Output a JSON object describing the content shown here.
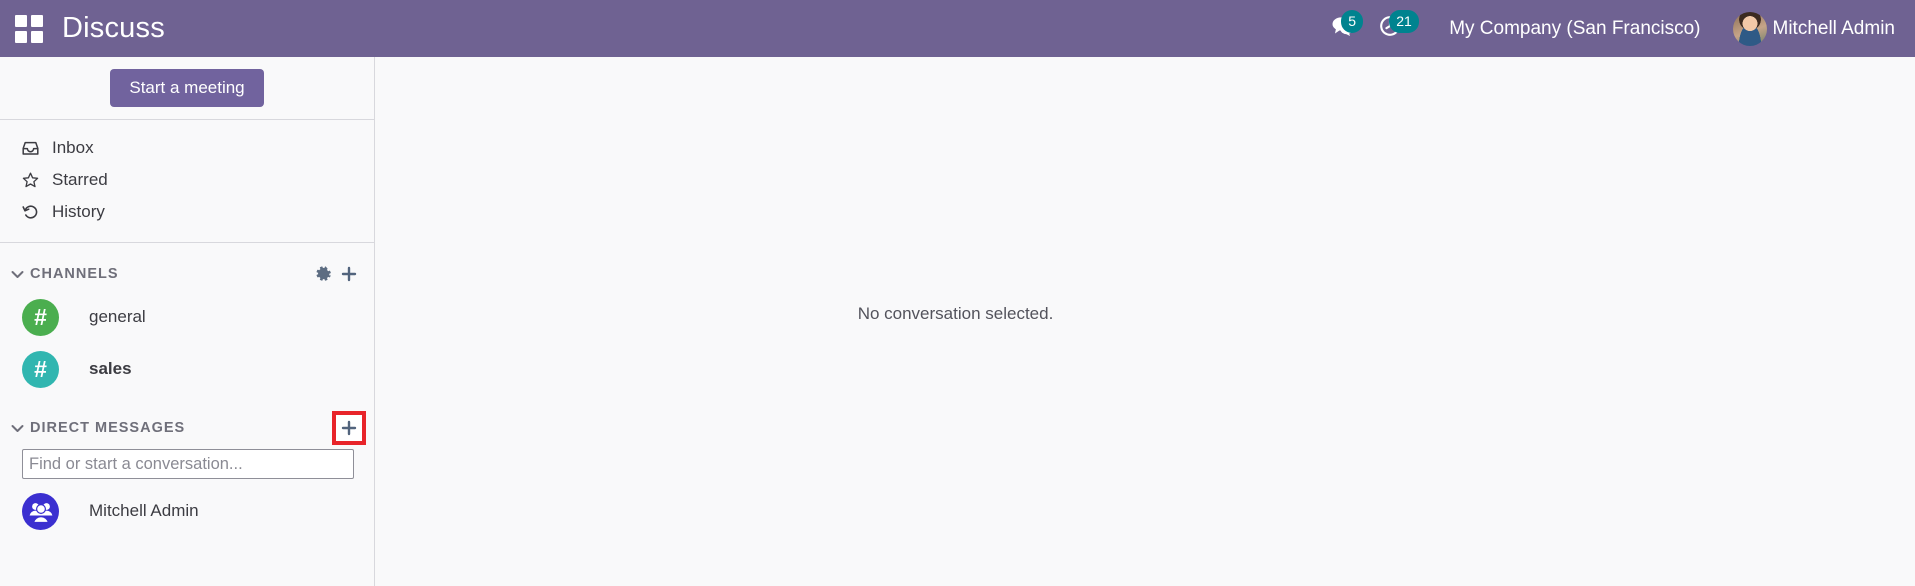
{
  "navbar": {
    "apps_menu_icon": "grid-apps-icon",
    "app_title": "Discuss",
    "messages_icon": "chat-bubbles-icon",
    "messages_count": "5",
    "activities_icon": "clock-activity-icon",
    "activities_count": "21",
    "company_name": "My Company (San Francisco)",
    "user_name": "Mitchell Admin",
    "avatar_icon": "user-avatar",
    "bg_color": "#6f6292",
    "badge_color": "#00838f"
  },
  "sidebar": {
    "start_meeting_label": "Start a meeting",
    "mailboxes": [
      {
        "label": "Inbox",
        "icon": "inbox-icon"
      },
      {
        "label": "Starred",
        "icon": "star-icon"
      },
      {
        "label": "History",
        "icon": "history-icon"
      }
    ],
    "channels_section": {
      "title": "CHANNELS",
      "caret_icon": "chevron-down-icon",
      "settings_icon": "gear-icon",
      "add_icon": "plus-icon",
      "items": [
        {
          "name": "general",
          "avatar_char": "#",
          "color": "#4bae4f",
          "bold": false
        },
        {
          "name": "sales",
          "avatar_char": "#",
          "color": "#31b6b0",
          "bold": true
        }
      ]
    },
    "direct_messages_section": {
      "title": "DIRECT MESSAGES",
      "caret_icon": "chevron-down-icon",
      "add_icon": "plus-icon",
      "add_button_highlight_color": "#e8242a",
      "search_value": "",
      "search_placeholder": "Find or start a conversation...",
      "items": [
        {
          "name": "Mitchell Admin",
          "avatar_icon": "group-users-icon",
          "color": "#3b2fd0"
        }
      ]
    }
  },
  "content": {
    "empty_state_text": "No conversation selected."
  }
}
